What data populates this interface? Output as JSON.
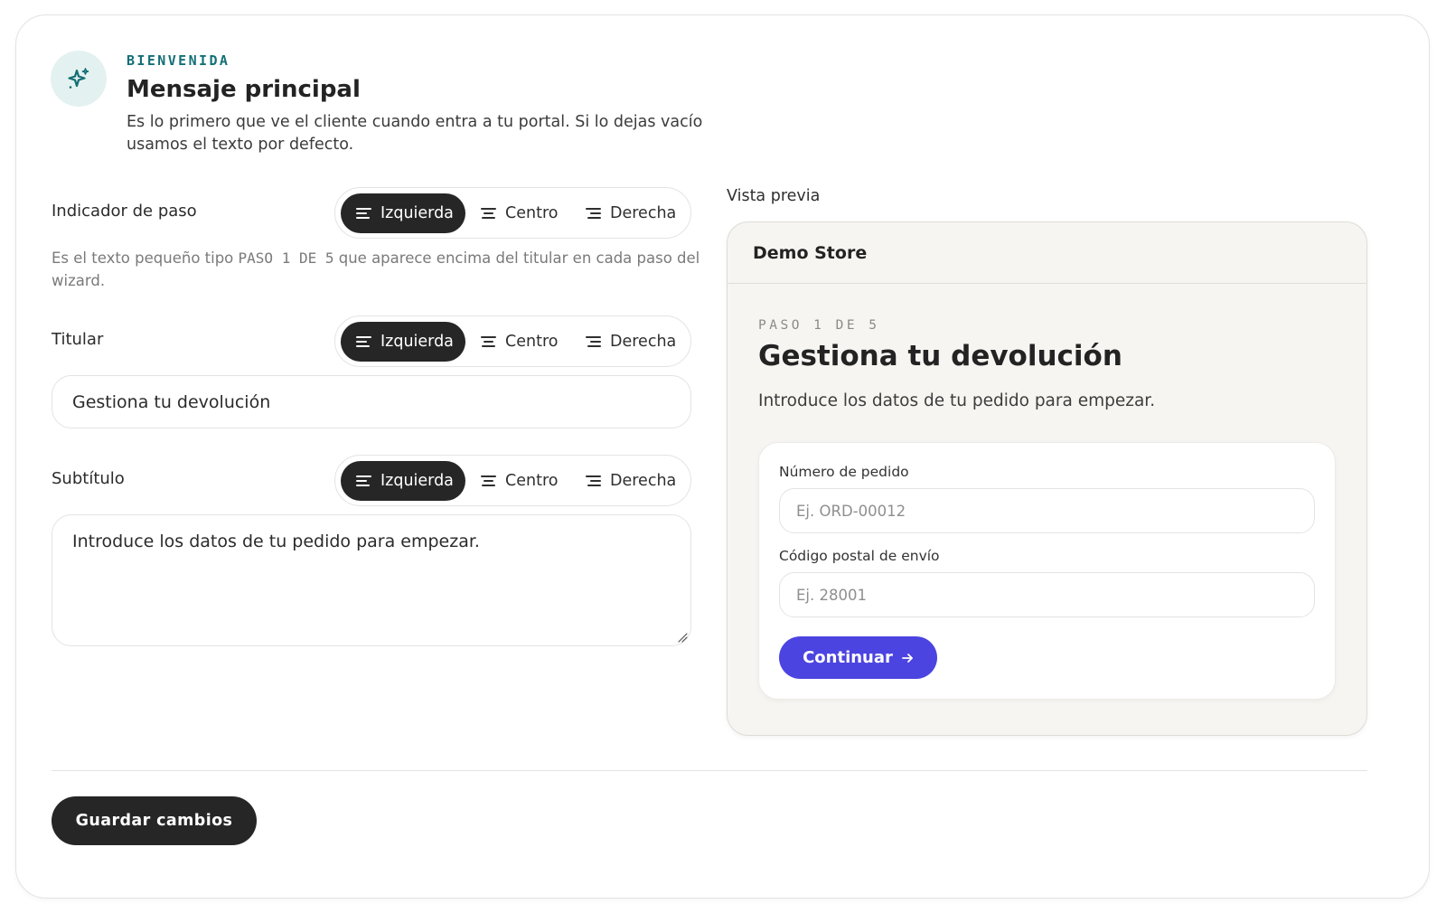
{
  "header": {
    "icon": "sparkles-icon",
    "eyebrow": "BIENVENIDA",
    "title": "Mensaje principal",
    "description": "Es lo primero que ve el cliente cuando entra a tu portal. Si lo dejas vacío usamos el texto por defecto."
  },
  "alignment_options": [
    "Izquierda",
    "Centro",
    "Derecha"
  ],
  "step_indicator": {
    "label": "Indicador de paso",
    "selected": "Izquierda",
    "help_before": "Es el texto pequeño tipo ",
    "help_code": "PASO 1 DE 5",
    "help_after": " que aparece encima del titular en cada paso del wizard."
  },
  "headline": {
    "label": "Titular",
    "selected": "Izquierda",
    "value": "Gestiona tu devolución"
  },
  "subtitle": {
    "label": "Subtítulo",
    "selected": "Izquierda",
    "value": "Introduce los datos de tu pedido para empezar."
  },
  "preview": {
    "label": "Vista previa",
    "store_name": "Demo Store",
    "step_text": "PASO 1 DE 5",
    "title": "Gestiona tu devolución",
    "subtitle": "Introduce los datos de tu pedido para empezar.",
    "fields": [
      {
        "label": "Número de pedido",
        "placeholder": "Ej. ORD-00012"
      },
      {
        "label": "Código postal de envío",
        "placeholder": "Ej. 28001"
      }
    ],
    "button_label": "Continuar",
    "button_color": "#4c44e0"
  },
  "footer": {
    "save_label": "Guardar cambios"
  },
  "colors": {
    "accent": "#136f75",
    "dark": "#262626",
    "preview_bg": "#f6f5f1"
  }
}
